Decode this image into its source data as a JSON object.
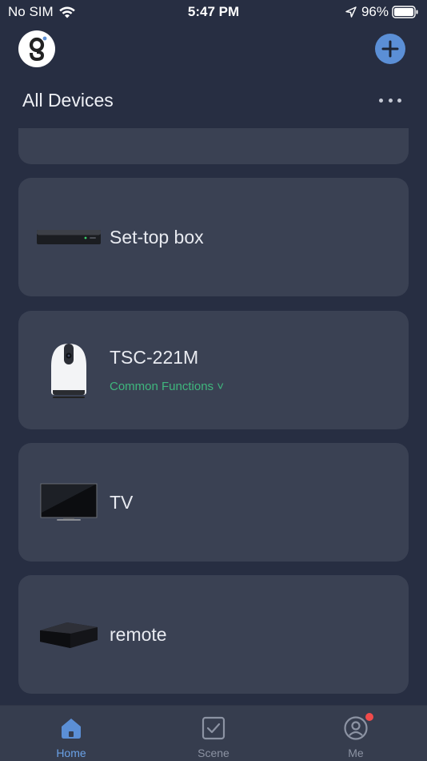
{
  "status_bar": {
    "carrier": "No SIM",
    "time": "5:47 PM",
    "battery": "96%"
  },
  "header": {
    "logo_icon": "g-logo-icon",
    "title": "All Devices",
    "add_icon": "plus-circle-icon",
    "more_icon": "ellipsis-icon"
  },
  "devices": [
    {
      "name": "Set-top box",
      "subtitle": "",
      "icon": "set-top-box-image"
    },
    {
      "name": "TSC-221M",
      "subtitle": "Common Functions ˅",
      "icon": "camera-image"
    },
    {
      "name": "TV",
      "subtitle": "",
      "icon": "tv-image"
    },
    {
      "name": "remote",
      "subtitle": "",
      "icon": "ir-remote-hub-image"
    }
  ],
  "tabs": [
    {
      "label": "Home",
      "icon": "home-icon",
      "active": true
    },
    {
      "label": "Scene",
      "icon": "checkbox-icon",
      "active": false
    },
    {
      "label": "Me",
      "icon": "user-circle-icon",
      "active": false,
      "badge": true
    }
  ],
  "colors": {
    "background": "#272e42",
    "card": "#3a4153",
    "accent": "#5b8fd6",
    "functions_green": "#3fb77d",
    "badge_red": "#f04b4b"
  }
}
